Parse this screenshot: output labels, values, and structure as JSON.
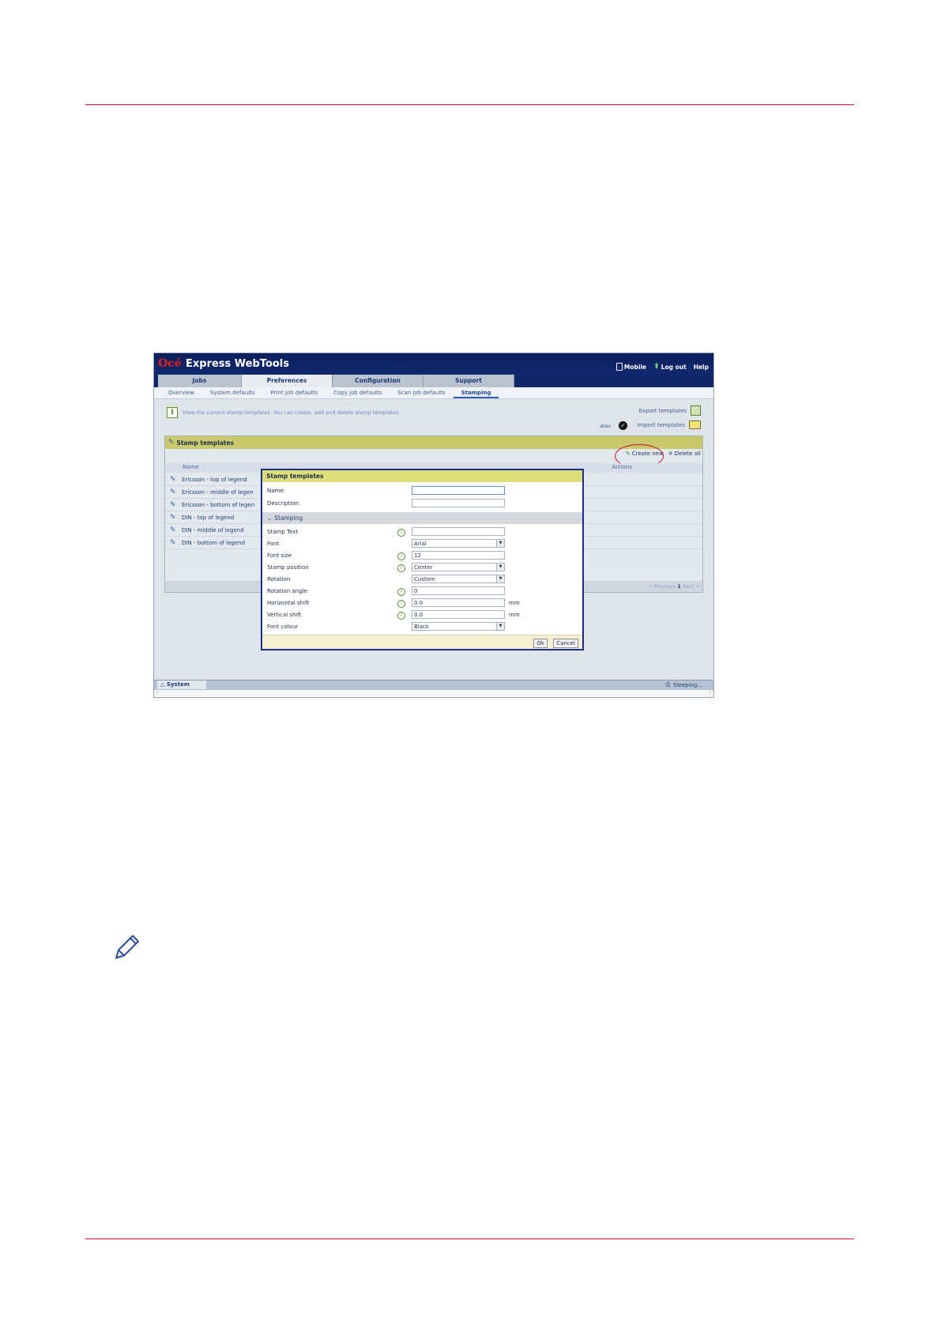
{
  "app": {
    "logo": "Océ",
    "title": "Express WebTools",
    "links": {
      "mobile": "Mobile",
      "logout": "Log out",
      "help": "Help"
    }
  },
  "main_tabs": [
    {
      "label": "Jobs"
    },
    {
      "label": "Preferences"
    },
    {
      "label": "Configuration"
    },
    {
      "label": "Support"
    }
  ],
  "sub_tabs": [
    {
      "label": "Overview"
    },
    {
      "label": "System defaults"
    },
    {
      "label": "Print job defaults"
    },
    {
      "label": "Copy job defaults"
    },
    {
      "label": "Scan job defaults"
    },
    {
      "label": "Stamping"
    }
  ],
  "info_text": "View the current stamp templates. You can create, edit and delete stamp templates.",
  "side_links": {
    "export": "Export templates",
    "import": "Import templates",
    "partial": "ates"
  },
  "panel": {
    "title": "Stamp templates",
    "create_new": "Create new",
    "delete_all": "Delete all",
    "col_name": "Name",
    "col_actions": "Actions",
    "rows": [
      {
        "label": "Ericsson - top of legend"
      },
      {
        "label": "Ericsson - middle of legen"
      },
      {
        "label": "Ericsson - bottom of legen"
      },
      {
        "label": "DIN - top of legend"
      },
      {
        "label": "DIN - middle of legend"
      },
      {
        "label": "DIN - bottom of legend"
      }
    ],
    "pager": {
      "prev": "« Previous",
      "page": "1",
      "next": "Next »"
    }
  },
  "dialog": {
    "title": "Stamp templates",
    "name_label": "Name:",
    "description_label": "Description:",
    "section": "Stamping",
    "fields": {
      "stamp_text": {
        "label": "Stamp Text",
        "value": ""
      },
      "font": {
        "label": "Font",
        "value": "Arial"
      },
      "font_size": {
        "label": "Font size",
        "value": "12"
      },
      "stamp_position": {
        "label": "Stamp position",
        "value": "Center"
      },
      "rotation": {
        "label": "Rotation",
        "value": "Custom"
      },
      "rotation_angle": {
        "label": "Rotation angle",
        "value": "0"
      },
      "horizontal_shift": {
        "label": "Horizontal shift",
        "value": "0.0",
        "unit": "mm"
      },
      "vertical_shift": {
        "label": "Vertical shift",
        "value": "0.0",
        "unit": "mm"
      },
      "font_colour": {
        "label": "Font colour",
        "value": "Black"
      }
    },
    "ok": "Ok",
    "cancel": "Cancel"
  },
  "status": {
    "system": "System",
    "state": "Sleeping..."
  },
  "colors": {
    "accent_rule": "#c8102e",
    "header": "#0c1f5c",
    "dialog_title": "#dede78"
  }
}
